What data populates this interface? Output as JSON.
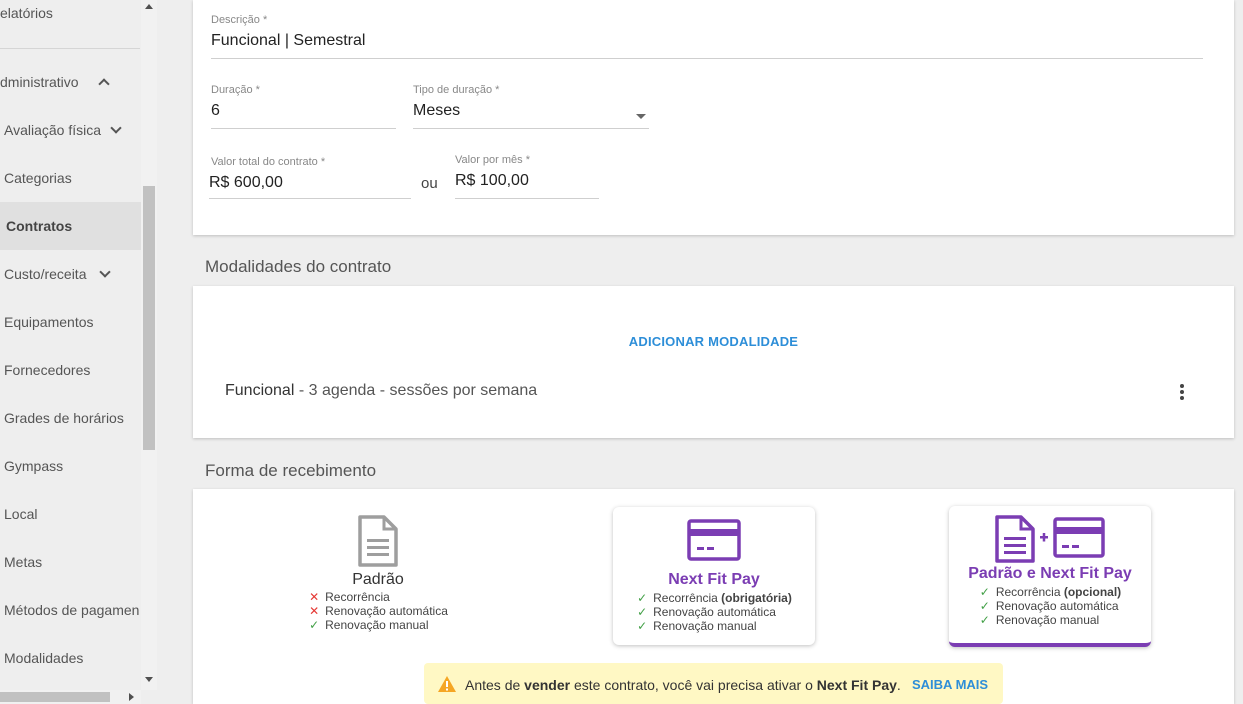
{
  "sidebar": {
    "items": [
      {
        "label": "elatórios"
      },
      {
        "label": "dministrativo"
      },
      {
        "label": "Avaliação física"
      },
      {
        "label": "Categorias"
      },
      {
        "label": "Contratos"
      },
      {
        "label": "Custo/receita"
      },
      {
        "label": "Equipamentos"
      },
      {
        "label": "Fornecedores"
      },
      {
        "label": "Grades de horários"
      },
      {
        "label": "Gympass"
      },
      {
        "label": "Local"
      },
      {
        "label": "Metas"
      },
      {
        "label": "Métodos de pagamen"
      },
      {
        "label": "Modalidades"
      }
    ]
  },
  "form": {
    "descricao": {
      "label": "Descrição *",
      "value": "Funcional | Semestral"
    },
    "duracao": {
      "label": "Duração *",
      "value": "6"
    },
    "tipo_duracao": {
      "label": "Tipo de duração *",
      "value": "Meses"
    },
    "valor_total": {
      "label": "Valor total do contrato *",
      "value": "R$ 600,00"
    },
    "ou": "ou",
    "valor_mes": {
      "label": "Valor por mês *",
      "value": "R$ 100,00"
    }
  },
  "modalidades": {
    "title": "Modalidades do contrato",
    "add_label": "ADICIONAR MODALIDADE",
    "item": {
      "name": "Funcional",
      "detail": " - 3 agenda - sessões por semana"
    }
  },
  "recebimento": {
    "title": "Forma de recebimento",
    "options": [
      {
        "title": "Padrão",
        "features": [
          {
            "mark": "✕",
            "text": "Recorrência",
            "bold": ""
          },
          {
            "mark": "✕",
            "text": "Renovação automática",
            "bold": ""
          },
          {
            "mark": "✓",
            "text": "Renovação manual",
            "bold": ""
          }
        ]
      },
      {
        "title": "Next Fit Pay",
        "features": [
          {
            "mark": "✓",
            "text": "Recorrência ",
            "bold": "(obrigatória)"
          },
          {
            "mark": "✓",
            "text": "Renovação automática",
            "bold": ""
          },
          {
            "mark": "✓",
            "text": "Renovação manual",
            "bold": ""
          }
        ]
      },
      {
        "title": "Padrão e Next Fit Pay",
        "features": [
          {
            "mark": "✓",
            "text": "Recorrência ",
            "bold": "(opcional)"
          },
          {
            "mark": "✓",
            "text": "Renovação automática",
            "bold": ""
          },
          {
            "mark": "✓",
            "text": "Renovação manual",
            "bold": ""
          }
        ]
      }
    ]
  },
  "alert": {
    "t1": "Antes de ",
    "b1": "vender",
    "t2": " este contrato, você vai precisa ativar o ",
    "b2": "Next Fit Pay",
    "t3": ".",
    "link": "SAIBA MAIS"
  },
  "colors": {
    "accent": "#2d8ed8",
    "purple": "#7b3db3",
    "alert_bg": "#fff8c4",
    "warn": "#f5a623"
  }
}
